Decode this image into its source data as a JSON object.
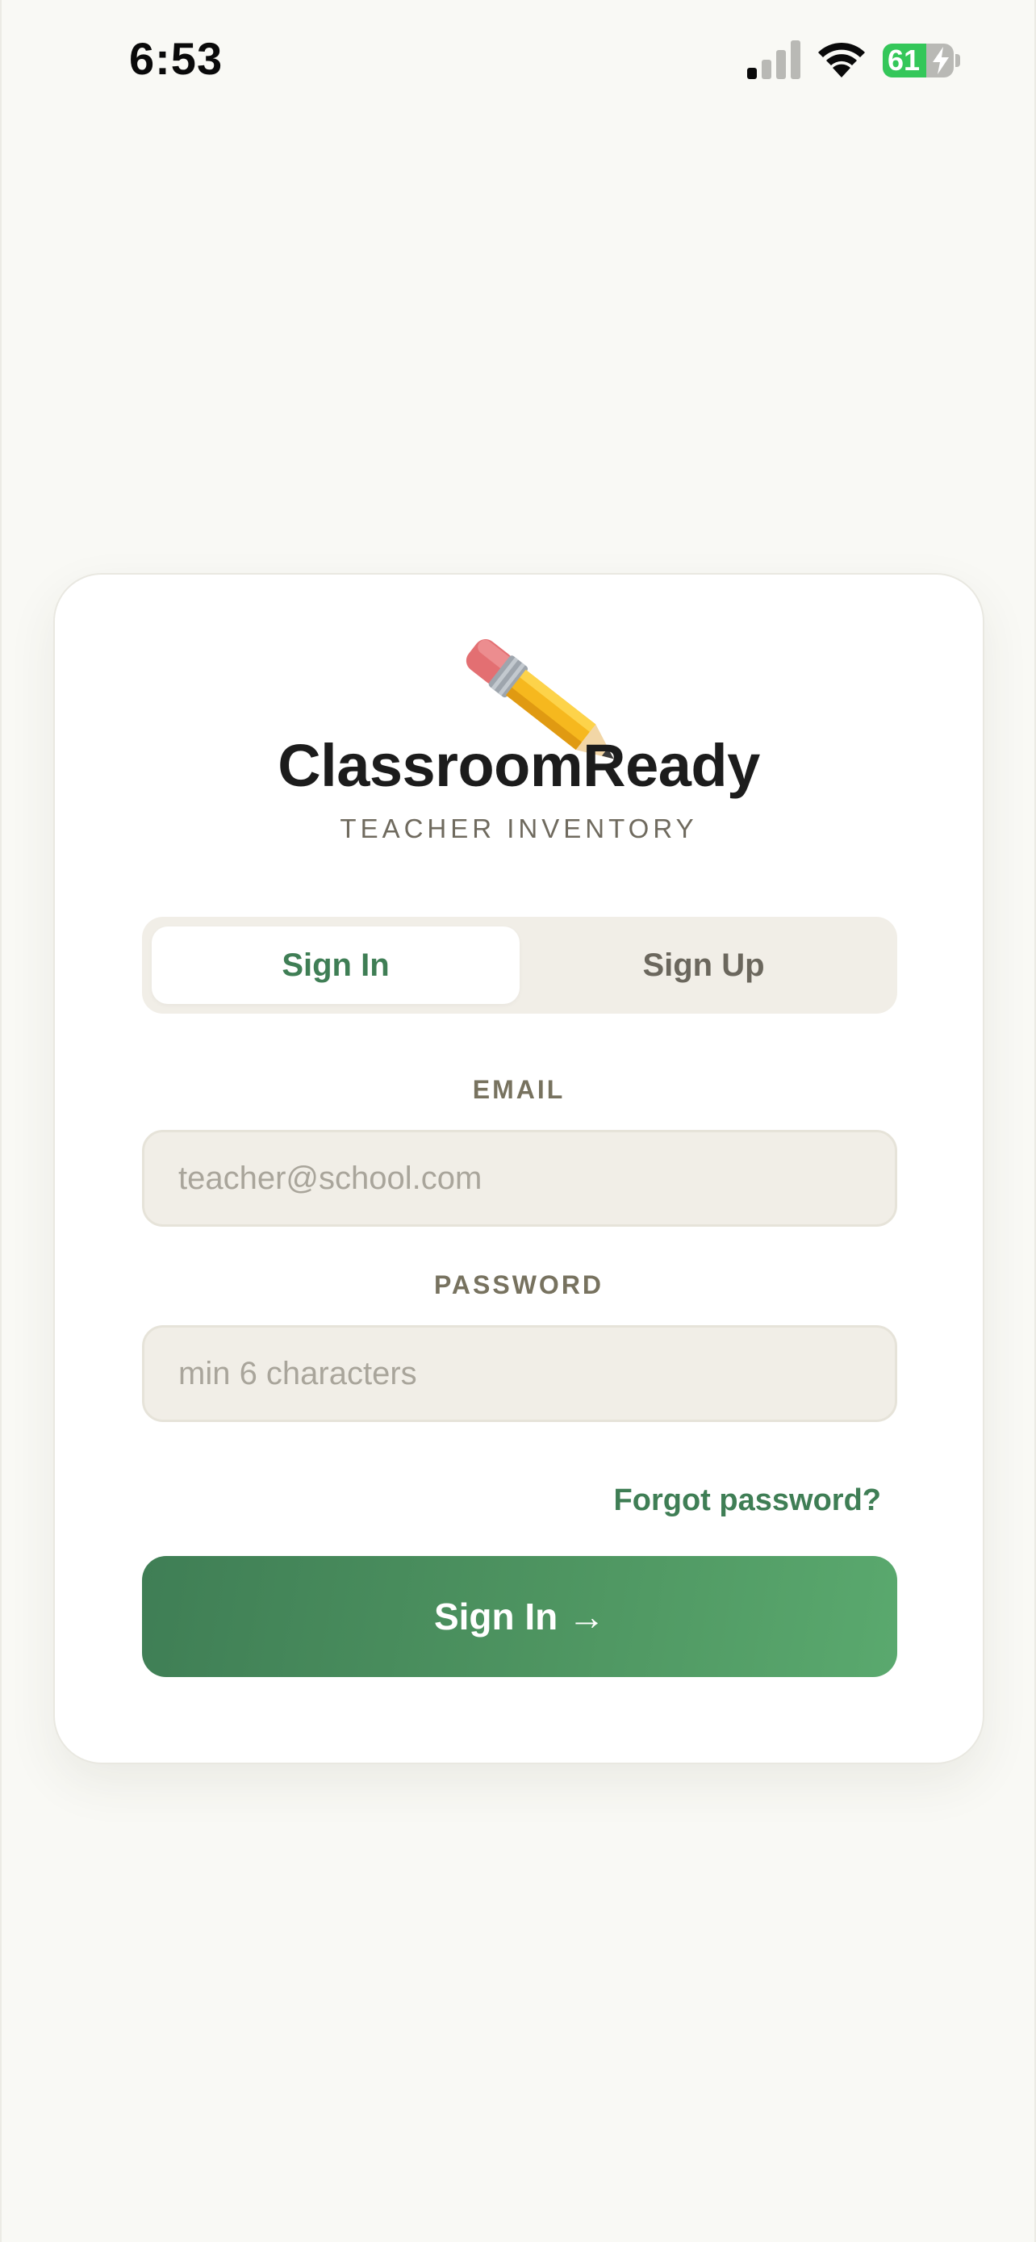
{
  "status_bar": {
    "time": "6:53",
    "battery_percent": "61",
    "battery_level": 0.61,
    "signal_bars_active": 1,
    "signal_bars_total": 4
  },
  "app": {
    "title": "ClassroomReady",
    "subtitle": "TEACHER INVENTORY",
    "logo_icon": "pencil-icon"
  },
  "tabs": [
    {
      "label": "Sign In",
      "active": true
    },
    {
      "label": "Sign Up",
      "active": false
    }
  ],
  "form": {
    "email_label": "EMAIL",
    "email_placeholder": "teacher@school.com",
    "email_value": "",
    "password_label": "PASSWORD",
    "password_placeholder": "min 6 characters",
    "password_value": "",
    "forgot_password": "Forgot password?",
    "submit_label": "Sign In →"
  },
  "colors": {
    "accent": "#3f7e55",
    "background": "#f9f9f5",
    "field_background": "#f1eee7",
    "battery_green": "#34c759"
  }
}
